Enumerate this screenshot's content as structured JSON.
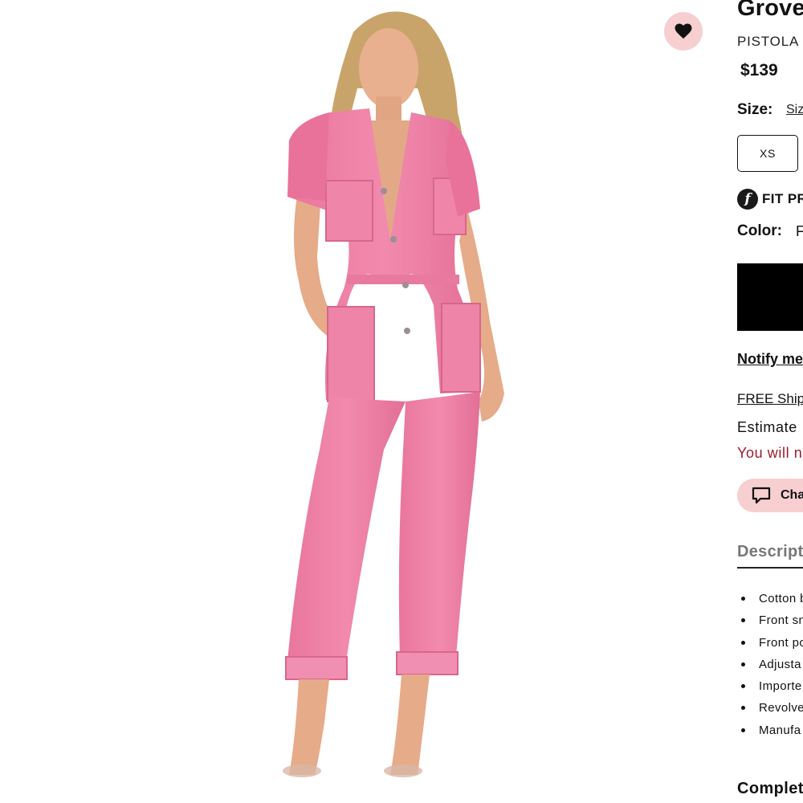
{
  "product": {
    "title": "Grove",
    "brand": "PISTOLA",
    "price": "$139"
  },
  "size": {
    "label": "Size:",
    "guide_link": "Siz",
    "options": [
      "XS"
    ]
  },
  "fit": {
    "icon_letter": "f",
    "label": "FIT PR"
  },
  "color": {
    "label": "Color:",
    "value": "F"
  },
  "actions": {
    "notify_link": "Notify me",
    "shipping_link": "FREE Ship",
    "estimate_text": "Estimate",
    "notice_text": "You will n",
    "chat_label": "Cha"
  },
  "description": {
    "header": "Descript",
    "items": [
      "Cotton b",
      "Front sn",
      "Front po",
      "Adjusta",
      "Importe",
      "Revolve",
      "Manufa"
    ]
  },
  "complete_look": "Complet",
  "colors": {
    "accent_pink": "#f7cfd1",
    "notice_red": "#9b1c2d",
    "jumpsuit_pink": "#ee82a6"
  },
  "icons": [
    "heart-icon",
    "fit-predictor-icon",
    "chat-icon"
  ]
}
